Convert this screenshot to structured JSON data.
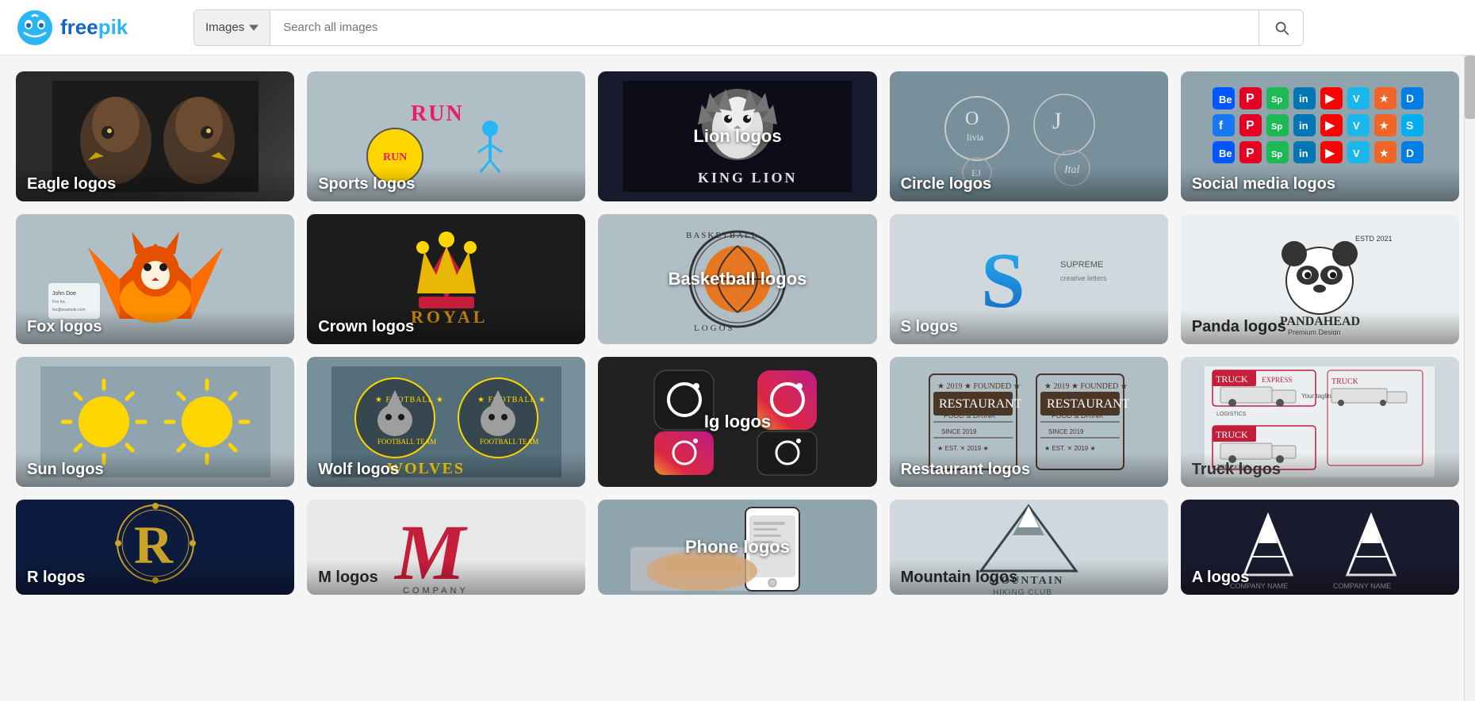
{
  "header": {
    "logo_text": "freepik",
    "search_dropdown_label": "Images",
    "search_placeholder": "Search all images",
    "search_button_label": "Search"
  },
  "grid": {
    "rows": [
      [
        {
          "id": "eagle",
          "label": "Eagle logos",
          "bg": "bg-eagle",
          "label_pos": "bottom"
        },
        {
          "id": "sports",
          "label": "Sports logos",
          "bg": "bg-sports",
          "label_pos": "bottom"
        },
        {
          "id": "lion",
          "label": "Lion logos",
          "bg": "bg-lion",
          "label_pos": "center"
        },
        {
          "id": "circle",
          "label": "Circle logos",
          "bg": "bg-circle",
          "label_pos": "bottom"
        },
        {
          "id": "social",
          "label": "Social media logos",
          "bg": "bg-social",
          "label_pos": "bottom"
        }
      ],
      [
        {
          "id": "fox",
          "label": "Fox logos",
          "bg": "bg-fox",
          "label_pos": "bottom"
        },
        {
          "id": "crown",
          "label": "Crown logos",
          "bg": "bg-crown",
          "label_pos": "bottom"
        },
        {
          "id": "basketball",
          "label": "Basketball logos",
          "bg": "bg-basketball",
          "label_pos": "center"
        },
        {
          "id": "s-logos",
          "label": "S logos",
          "bg": "bg-s-logos",
          "label_pos": "bottom"
        },
        {
          "id": "panda",
          "label": "Panda logos",
          "bg": "bg-panda",
          "label_pos": "bottom"
        }
      ],
      [
        {
          "id": "sun",
          "label": "Sun logos",
          "bg": "bg-sun",
          "label_pos": "bottom"
        },
        {
          "id": "wolf",
          "label": "Wolf logos",
          "bg": "bg-wolf",
          "label_pos": "bottom"
        },
        {
          "id": "ig",
          "label": "Ig logos",
          "bg": "bg-ig",
          "label_pos": "center"
        },
        {
          "id": "restaurant",
          "label": "Restaurant logos",
          "bg": "bg-restaurant",
          "label_pos": "bottom"
        },
        {
          "id": "truck",
          "label": "Truck logos",
          "bg": "bg-truck",
          "label_pos": "bottom"
        }
      ],
      [
        {
          "id": "r",
          "label": "R logos",
          "bg": "bg-r",
          "label_pos": "bottom"
        },
        {
          "id": "m",
          "label": "M logos",
          "bg": "bg-m",
          "label_pos": "bottom"
        },
        {
          "id": "phone",
          "label": "Phone logos",
          "bg": "bg-phone",
          "label_pos": "center"
        },
        {
          "id": "mountain",
          "label": "Mountain logos",
          "bg": "bg-mountain",
          "label_pos": "bottom"
        },
        {
          "id": "a-logos",
          "label": "A logos",
          "bg": "bg-a",
          "label_pos": "bottom"
        }
      ]
    ]
  },
  "social_icons": [
    {
      "label": "Be",
      "color": "#0057ff"
    },
    {
      "label": "P",
      "color": "#e60023"
    },
    {
      "label": "Sp",
      "color": "#1db954"
    },
    {
      "label": "in",
      "color": "#0077b5"
    },
    {
      "label": "▶",
      "color": "#ff0000"
    },
    {
      "label": "V",
      "color": "#1ab7ea"
    },
    {
      "label": "★",
      "color": "#f16529"
    },
    {
      "label": "D",
      "color": "#007ee5"
    },
    {
      "label": "f",
      "color": "#1877f2"
    },
    {
      "label": "P",
      "color": "#e60023"
    },
    {
      "label": "Sp",
      "color": "#1db954"
    },
    {
      "label": "in",
      "color": "#0077b5"
    },
    {
      "label": "▶",
      "color": "#ff0000"
    },
    {
      "label": "V",
      "color": "#1ab7ea"
    },
    {
      "label": "★",
      "color": "#f16529"
    },
    {
      "label": "S",
      "color": "#00aff0"
    }
  ]
}
